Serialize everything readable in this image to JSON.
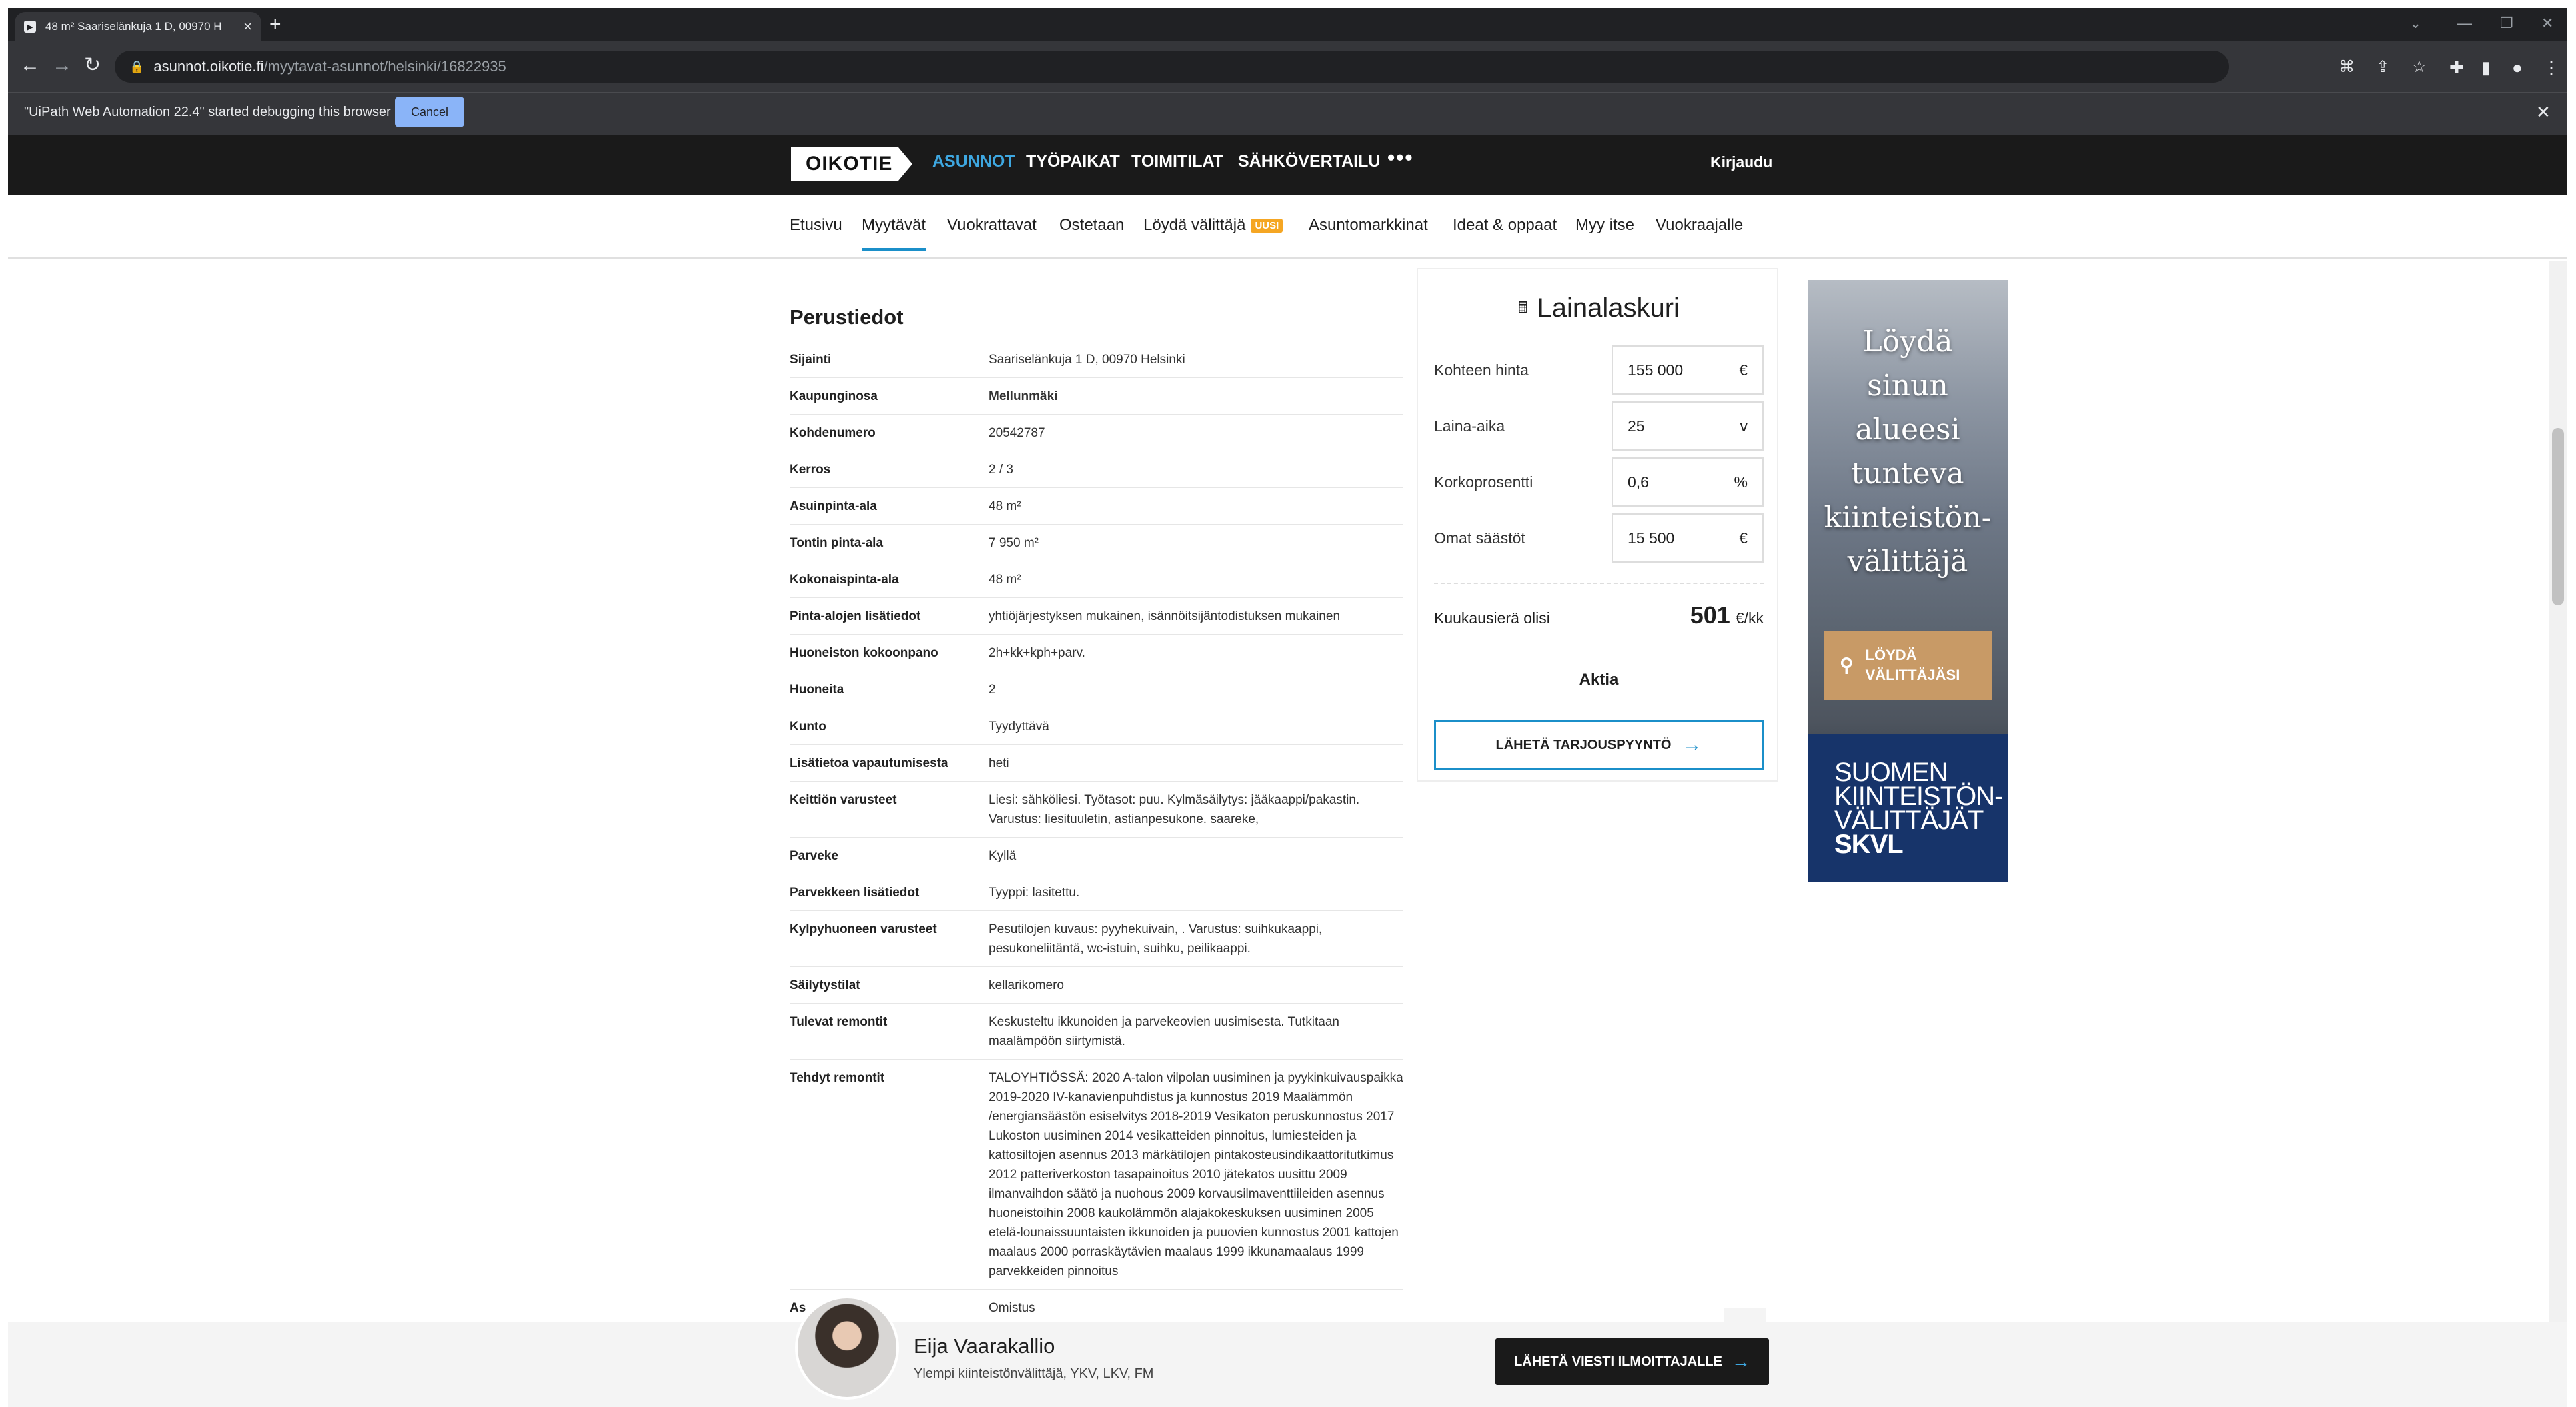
{
  "browser": {
    "tab_title": "48 m² Saariselänkuja 1 D, 00970 H",
    "url_host": "asunnot.oikotie.fi",
    "url_path": "/myytavat-asunnot/helsinki/16822935",
    "infobar_msg": "\"UiPath Web Automation 22.4\" started debugging this browser",
    "cancel": "Cancel"
  },
  "header": {
    "logo": "OIKOTIE",
    "nav": [
      "ASUNNOT",
      "TYÖPAIKAT",
      "TOIMITILAT",
      "SÄHKÖVERTAILU"
    ],
    "more": "•••",
    "login": "Kirjaudu"
  },
  "subnav": {
    "items": [
      "Etusivu",
      "Myytävät",
      "Vuokrattavat",
      "Ostetaan",
      "Löydä välittäjä",
      "Asuntomarkkinat",
      "Ideat & oppaat",
      "Myy itse",
      "Vuokraajalle"
    ],
    "badge": "UUSI"
  },
  "details": {
    "title": "Perustiedot",
    "rows": [
      {
        "k": "Sijainti",
        "v": "Saariselänkuja 1 D, 00970 Helsinki"
      },
      {
        "k": "Kaupunginosa",
        "v": "Mellunmäki"
      },
      {
        "k": "Kohdenumero",
        "v": "20542787"
      },
      {
        "k": "Kerros",
        "v": "2 / 3"
      },
      {
        "k": "Asuinpinta-ala",
        "v": "48 m²"
      },
      {
        "k": "Tontin pinta-ala",
        "v": "7 950 m²"
      },
      {
        "k": "Kokonaispinta-ala",
        "v": "48 m²"
      },
      {
        "k": "Pinta-alojen lisätiedot",
        "v": "yhtiöjärjestyksen mukainen, isännöitsijäntodistuksen mukainen"
      },
      {
        "k": "Huoneiston kokoonpano",
        "v": "2h+kk+kph+parv."
      },
      {
        "k": "Huoneita",
        "v": "2"
      },
      {
        "k": "Kunto",
        "v": "Tyydyttävä"
      },
      {
        "k": "Lisätietoa vapautumisesta",
        "v": "heti"
      },
      {
        "k": "Keittiön varusteet",
        "v": "Liesi: sähköliesi. Työtasot: puu. Kylmäsäilytys: jääkaappi/pakastin. Varustus: liesituuletin, astianpesukone. saareke,"
      },
      {
        "k": "Parveke",
        "v": "Kyllä"
      },
      {
        "k": "Parvekkeen lisätiedot",
        "v": "Tyyppi: lasitettu."
      },
      {
        "k": "Kylpyhuoneen varusteet",
        "v": "Pesutilojen kuvaus: pyyhekuivain, . Varustus: suihkukaappi, pesukoneliitäntä, wc-istuin, suihku, peilikaappi."
      },
      {
        "k": "Säilytystilat",
        "v": "kellarikomero"
      },
      {
        "k": "Tulevat remontit",
        "v": "Keskusteltu ikkunoiden ja parvekeovien uusimisesta. Tutkitaan maalämpöön siirtymistä."
      },
      {
        "k": "Tehdyt remontit",
        "v": "TALOYHTIÖSSÄ: 2020 A-talon vilpolan uusiminen ja pyykinkuivauspaikka 2019-2020 IV-kanavienpuhdistus ja kunnostus 2019 Maalämmön /energiansäästön esiselvitys 2018-2019 Vesikaton peruskunnostus 2017 Lukoston uusiminen 2014 vesikatteiden pinnoitus, lumiesteiden ja kattosiltojen asennus 2013 märkätilojen pintakosteusindikaattoritutkimus 2012 patteriverkoston tasapainoitus 2010 jätekatos uusittu 2009 ilmanvaihdon säätö ja nuohous 2009 korvausilmaventtiileiden asennus huoneistoihin 2008 kaukolämmön alajakokeskuksen uusiminen 2005 etelä-lounaissuuntaisten ikkunoiden ja puuovien kunnostus 2001 kattojen maalaus 2000 porraskäytävien maalaus 1999 ikkunamaalaus 1999 parvekkeiden pinnoitus"
      },
      {
        "k": "As",
        "v": "Omistus"
      }
    ]
  },
  "calc": {
    "title": "Lainalaskuri",
    "fields": [
      {
        "label": "Kohteen hinta",
        "value": "155 000",
        "unit": "€"
      },
      {
        "label": "Laina-aika",
        "value": "25",
        "unit": "v"
      },
      {
        "label": "Korkoprosentti",
        "value": "0,6",
        "unit": "%"
      },
      {
        "label": "Omat säästöt",
        "value": "15 500",
        "unit": "€"
      }
    ],
    "result_label": "Kuukausierä olisi",
    "result_value": "501",
    "result_unit": "€/kk",
    "bank": "Aktia",
    "button": "LÄHETÄ TARJOUSPYYNTÖ"
  },
  "ad": {
    "lines": [
      "Löydä",
      "sinun",
      "alueesi",
      "tunteva",
      "kiinteistön-",
      "välittäjä"
    ],
    "button_l1": "LÖYDÄ",
    "button_l2": "VÄLITTÄJÄSI",
    "blue_l1": "SUOMEN",
    "blue_l2": "KIINTEISTÖN-",
    "blue_l3": "VÄLITTÄJÄT",
    "blue_l4": "SKVL"
  },
  "agent": {
    "name": "Eija Vaarakallio",
    "title": "Ylempi kiinteistönvälittäjä, YKV, LKV, FM",
    "button": "LÄHETÄ VIESTI ILMOITTAJALLE"
  },
  "colors": {
    "accent": "#1b8fc9",
    "header_bg": "#1a1a1a",
    "badge": "#f5a623"
  }
}
